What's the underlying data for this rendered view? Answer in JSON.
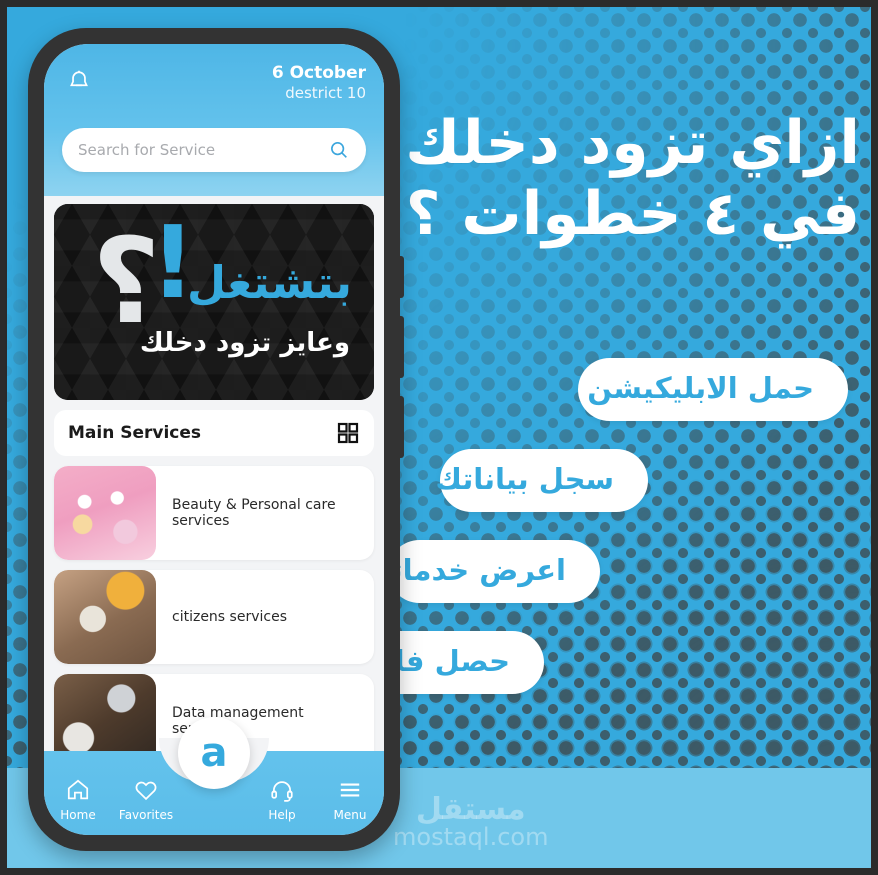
{
  "poster": {
    "background_color": "#35a9dd",
    "dot_color": "#3d5a66",
    "accent_color": "#35a9dd",
    "headline_line1": "ازاي تزود دخلك",
    "headline_line2": "في ٤ خطوات ؟",
    "steps": [
      {
        "label": "حمل الابليكيشن"
      },
      {
        "label": "سجل بياناتك"
      },
      {
        "label": "اعرض خدماتك"
      },
      {
        "label": "حصل فلوسك"
      }
    ],
    "watermark_ar": "مستقل",
    "watermark_en": "mostaql.com"
  },
  "phone": {
    "header": {
      "bell_icon": "bell-icon",
      "location_city": "6 October",
      "location_district": "destrict 10",
      "search_placeholder": "Search for Service",
      "search_icon": "search-icon"
    },
    "banner": {
      "question_mark": "؟",
      "exclamation": "!",
      "title": "بتشتغل",
      "subtitle": "وعايز تزود دخلك"
    },
    "services_section": {
      "title": "Main Services",
      "grid_icon": "grid-icon",
      "items": [
        {
          "label": "Beauty & Personal care services",
          "thumb": "thumb-beauty"
        },
        {
          "label": "citizens services",
          "thumb": "thumb-citizens"
        },
        {
          "label": "Data management services",
          "thumb": "thumb-data"
        }
      ]
    },
    "bottom_nav": {
      "items": [
        {
          "label": "Home",
          "icon": "home-icon"
        },
        {
          "label": "Favorites",
          "icon": "heart-icon"
        },
        {
          "label": "Help",
          "icon": "headset-icon"
        },
        {
          "label": "Menu",
          "icon": "hamburger-icon"
        }
      ],
      "fab_logo": "a"
    }
  }
}
